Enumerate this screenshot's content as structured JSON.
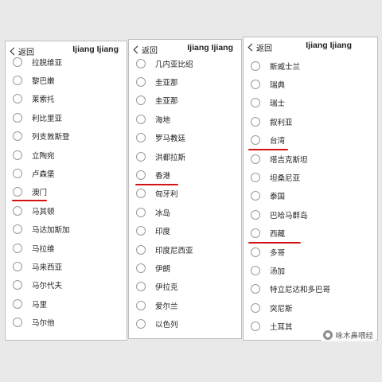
{
  "panels": [
    {
      "back_label": "返回",
      "title": "Ijiang Ijiang",
      "items": [
        "拉脱维亚",
        "黎巴嫩",
        "莱索托",
        "利比里亚",
        "列支敦斯登",
        "立陶宛",
        "卢森堡",
        "澳门",
        "马其顿",
        "马达加斯加",
        "马拉维",
        "马来西亚",
        "马尔代夫",
        "马里",
        "马尔他"
      ],
      "highlighted": "澳门"
    },
    {
      "back_label": "返回",
      "title": "Ijiang Ijiang",
      "items": [
        "几内亚比绍",
        "圭亚那",
        "圭亚那",
        "海地",
        "罗马教廷",
        "洪都拉斯",
        "香港",
        "匈牙利",
        "冰岛",
        "印度",
        "印度尼西亚",
        "伊朗",
        "伊拉克",
        "爱尔兰",
        "以色列"
      ],
      "highlighted": "香港"
    },
    {
      "back_label": "返回",
      "title": "Ijiang Ijiang",
      "items": [
        "斯威士兰",
        "瑞典",
        "瑞士",
        "叙利亚",
        "台湾",
        "塔吉克斯坦",
        "坦桑尼亚",
        "泰国",
        "巴哈马群岛",
        "西藏",
        "多哥",
        "汤加",
        "特立尼达和多巴哥",
        "突尼斯",
        "土耳其"
      ],
      "highlighted": [
        "台湾",
        "西藏"
      ]
    }
  ],
  "watermark": {
    "text": "咏木鼻喂经"
  },
  "colors": {
    "underline": "#d41414",
    "panel_bg": "#ffffff",
    "page_bg": "#e9e9e9"
  }
}
